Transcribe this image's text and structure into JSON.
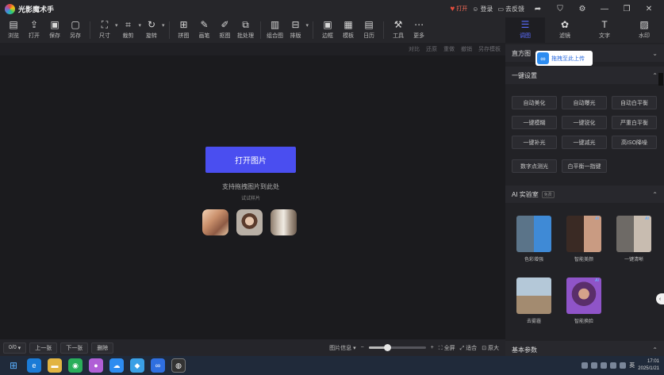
{
  "app": {
    "name": "光影魔术手"
  },
  "titlebar": {
    "open_label": "打开",
    "login_label": "登录",
    "feedback_label": "去反馈",
    "window_buttons": [
      "chevron-down-icon",
      "minimize-icon",
      "restore-icon",
      "close-icon"
    ]
  },
  "toolbar": {
    "items": [
      {
        "label": "浏览",
        "icon": "browse-icon"
      },
      {
        "label": "打开",
        "icon": "open-icon"
      },
      {
        "label": "保存",
        "icon": "save-icon"
      },
      {
        "label": "另存",
        "icon": "save-as-icon"
      },
      {
        "label": "尺寸",
        "icon": "resize-icon"
      },
      {
        "label": "裁剪",
        "icon": "crop-icon"
      },
      {
        "label": "旋转",
        "icon": "rotate-icon"
      },
      {
        "label": "拼图",
        "icon": "collage-icon"
      },
      {
        "label": "画笔",
        "icon": "brush-icon"
      },
      {
        "label": "抠图",
        "icon": "cutout-icon"
      },
      {
        "label": "批处理",
        "icon": "batch-icon"
      },
      {
        "label": "组合图",
        "icon": "combine-icon"
      },
      {
        "label": "排版",
        "icon": "layout-icon"
      },
      {
        "label": "边框",
        "icon": "frame-icon"
      },
      {
        "label": "模板",
        "icon": "template-icon"
      },
      {
        "label": "日历",
        "icon": "calendar-icon"
      },
      {
        "label": "工具",
        "icon": "tools-icon"
      },
      {
        "label": "更多",
        "icon": "more-icon"
      }
    ]
  },
  "subbar": {
    "items": [
      "对比",
      "还原",
      "重做",
      "撤销",
      "另存模板"
    ]
  },
  "canvas": {
    "open_button": "打开图片",
    "drag_hint": "支持拖拽图片到此处",
    "try_link": "试试样片"
  },
  "bottombar": {
    "page_indicator": "0/0",
    "prev_label": "上一张",
    "next_label": "下一张",
    "delete_label": "删除",
    "image_info_label": "图片信息",
    "zoom_fraction": 0.32,
    "fit_label": "全屏",
    "fit_window_label": "适合",
    "original_label": "原大"
  },
  "right_tabs": [
    {
      "label": "调图",
      "icon": "sliders-icon",
      "active": true
    },
    {
      "label": "滤镜",
      "icon": "filter-icon",
      "active": false
    },
    {
      "label": "文字",
      "icon": "text-icon",
      "active": false
    },
    {
      "label": "水印",
      "icon": "watermark-icon",
      "active": false
    }
  ],
  "right_panel": {
    "histogram_label": "直方图",
    "upload_label": "拖拽至此上传",
    "quick_settings": {
      "title": "一键设置",
      "buttons": [
        "自动美化",
        "自动曝光",
        "自动白平衡",
        "一键模糊",
        "一键锐化",
        "严重白平衡",
        "一键补光",
        "一键减光",
        "高ISO降噪",
        "数字点测光",
        "白平衡一指键"
      ]
    },
    "ai_lab": {
      "title": "AI 实验室",
      "badge": "免费",
      "cards": [
        {
          "label": "色彩增强"
        },
        {
          "label": "智能美颜"
        },
        {
          "label": "一键清晰"
        },
        {
          "label": "去雾霾"
        },
        {
          "label": "智能换脸"
        }
      ],
      "tag": "Ai"
    },
    "basic_params": {
      "title": "基本参数"
    }
  },
  "taskbar": {
    "time": "17:01",
    "date": "2025/1/21",
    "input_method": "英"
  },
  "colors": {
    "accent": "#4a4ef0",
    "active_tab": "#5b6cff",
    "background": "#1b1b1e",
    "panel": "#222226"
  }
}
